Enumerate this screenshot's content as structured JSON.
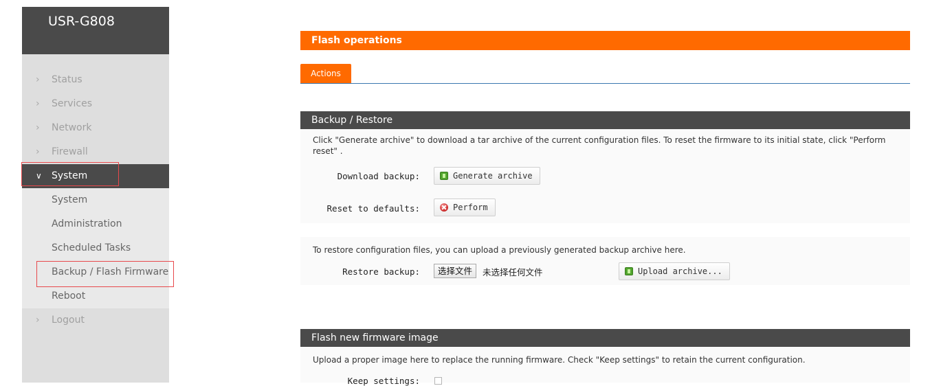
{
  "sidebar": {
    "brand": "USR-G808",
    "menu": [
      {
        "label": "Status"
      },
      {
        "label": "Services"
      },
      {
        "label": "Network"
      },
      {
        "label": "Firewall"
      },
      {
        "label": "System"
      },
      {
        "label": "Logout"
      }
    ],
    "system_submenu": [
      {
        "label": "System"
      },
      {
        "label": "Administration"
      },
      {
        "label": "Scheduled Tasks"
      },
      {
        "label": "Backup / Flash Firmware"
      },
      {
        "label": "Reboot"
      }
    ]
  },
  "main": {
    "page_title": "Flash operations",
    "tabs": [
      {
        "label": "Actions"
      }
    ],
    "backup_restore": {
      "title": "Backup / Restore",
      "description": "Click \"Generate archive\" to download a tar archive of the current configuration files. To reset the firmware to its initial state, click \"Perform reset\" .",
      "download_label": "Download backup:",
      "generate_button": "Generate archive",
      "reset_label": "Reset to defaults:",
      "perform_button": "Perform",
      "restore_description": "To restore configuration files, you can upload a previously generated backup archive here.",
      "restore_label": "Restore backup:",
      "file_button": "选择文件",
      "file_status": "未选择任何文件",
      "upload_button": "Upload archive..."
    },
    "flash_firmware": {
      "title": "Flash new firmware image",
      "description": "Upload a proper image here to replace the running firmware. Check \"Keep settings\" to retain the current configuration.",
      "keep_label": "Keep settings:",
      "keep_checked": false
    }
  },
  "colors": {
    "accent_orange": "#ff6a00",
    "dark_header": "#4a4a4a",
    "sidebar_bg": "#dedede",
    "highlight_red": "#e8484b"
  }
}
